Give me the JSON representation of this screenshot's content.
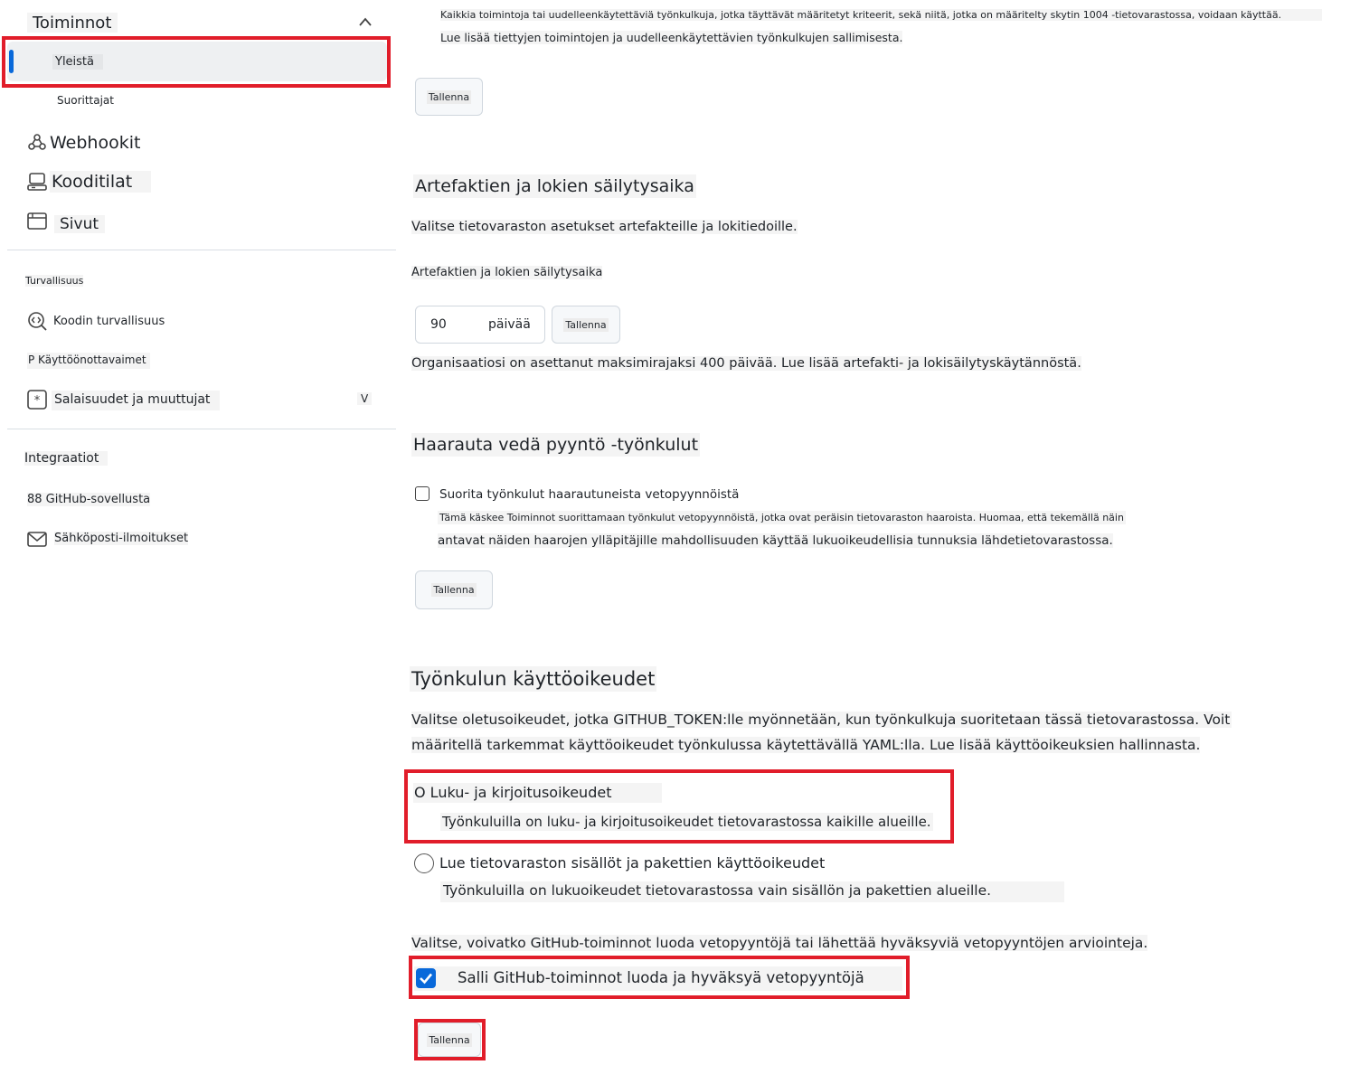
{
  "sidebar": {
    "actions_title": "Toiminnot",
    "actions_items": [
      "Yleistä",
      "Suorittajat"
    ],
    "webhooks": "Webhookit",
    "codespaces": "Kooditilat",
    "pages": "Sivut",
    "security_heading": "Turvallisuus",
    "code_security": "Koodin turvallisuus",
    "deploy_keys": "P Käyttöönottavaimet",
    "secrets": "Salaisuudet ja muuttujat",
    "secrets_chevron": "V",
    "integrations_heading": "Integraatiot",
    "github_apps": "88 GitHub-sovellusta",
    "email": "Sähköposti-ilmoitukset"
  },
  "top": {
    "line1": "Kaikkia toimintoja tai uudelleenkäytettäviä työnkulkuja, jotka täyttävät määritetyt kriteerit, sekä niitä, jotka on määritelty skytin 1004 -tietovarastossa, voidaan käyttää.",
    "line2": "Lue lisää tiettyjen toimintojen ja uudelleenkäytettävien työnkulkujen sallimisesta.",
    "save": "Tallenna"
  },
  "retention": {
    "title": "Artefaktien ja lokien säilytysaika",
    "desc": "Valitse tietovaraston asetukset artefakteille ja lokitiedoille.",
    "label": "Artefaktien ja lokien säilytysaika",
    "value": "90",
    "unit": "päivää",
    "save": "Tallenna",
    "note": "Organisaatiosi on asettanut maksimirajaksi 400 päivää. Lue lisää artefakti- ja lokisäilytyskäytännöstä."
  },
  "fork": {
    "title": "Haarauta vedä pyyntö -työnkulut",
    "checkbox_label": "Suorita työnkulut haarautuneista vetopyynnöistä",
    "checked": false,
    "help1": "Tämä käskee Toiminnot suorittamaan työnkulut vetopyynnöistä, jotka ovat peräisin tietovaraston haaroista. Huomaa, että tekemällä näin",
    "help2": "antavat näiden haarojen ylläpitäjille mahdollisuuden käyttää lukuoikeudellisia tunnuksia lähdetietovarastossa.",
    "save": "Tallenna"
  },
  "permissions": {
    "title": "Työnkulun käyttöoikeudet",
    "desc1": "Valitse oletusoikeudet, jotka GITHUB_TOKEN:lle myönnetään, kun työnkulkuja suoritetaan tässä tietovarastossa. Voit",
    "desc2": "määritellä tarkemmat käyttöoikeudet työnkulussa käytettävällä YAML:lla. Lue lisää käyttöoikeuksien hallinnasta.",
    "option_rw_label": "O Luku- ja kirjoitusoikeudet",
    "option_rw_desc": "Työnkuluilla on luku- ja kirjoitusoikeudet tietovarastossa kaikille alueille.",
    "option_read_label": "Lue tietovaraston sisällöt ja pakettien käyttöoikeudet",
    "option_read_desc": "Työnkuluilla on lukuoikeudet tietovarastossa vain sisällön ja pakettien alueille.",
    "pr_desc": "Valitse, voivatko GitHub-toiminnot luoda vetopyyntöjä tai lähettää hyväksyviä vetopyyntöjen arviointeja.",
    "allow_pr_label": "Salli GitHub-toiminnot luoda ja hyväksyä vetopyyntöjä",
    "allow_pr_checked": true,
    "save": "Tallenna"
  },
  "colors": {
    "accent": "#0969da",
    "highlight": "#e11d2a"
  }
}
